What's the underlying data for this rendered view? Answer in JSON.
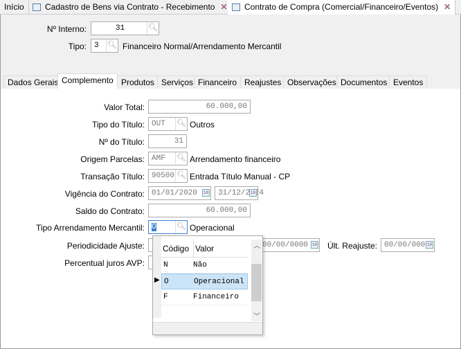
{
  "top_tabs": [
    {
      "label": "Início"
    },
    {
      "label": "Cadastro de Bens via Contrato - Recebimento"
    },
    {
      "label": "Contrato de Compra (Comercial/Financeiro/Eventos)"
    }
  ],
  "header": {
    "interno_label": "Nº Interno:",
    "interno_value": "31",
    "tipo_label": "Tipo:",
    "tipo_value": "3",
    "tipo_desc": "Financeiro Normal/Arrendamento Mercantil"
  },
  "tabs": [
    "Dados Gerais",
    "Complemento",
    "Produtos",
    "Serviços",
    "Financeiro",
    "Reajustes",
    "Observações",
    "Documentos",
    "Eventos"
  ],
  "form": {
    "valor_total_label": "Valor Total:",
    "valor_total": "60.000,00",
    "tipo_titulo_label": "Tipo do Título:",
    "tipo_titulo": "OUT",
    "tipo_titulo_desc": "Outros",
    "num_titulo_label": "Nº do Título:",
    "num_titulo": "31",
    "origem_label": "Origem Parcelas:",
    "origem": "AMF",
    "origem_desc": "Arrendamento financeiro",
    "transacao_label": "Transação Título:",
    "transacao": "90500",
    "transacao_desc": "Entrada Título Manual - CP",
    "vigencia_label": "Vigência do Contrato:",
    "vigencia_inicio": "01/01/2020",
    "vigencia_fim": "31/12/2024",
    "saldo_label": "Saldo do Contrato:",
    "saldo": "60.000,00",
    "arrend_label": "Tipo Arrendamento Mercantil:",
    "arrend": "O",
    "arrend_desc": "Operacional",
    "periodicidade_label": "Periodicidade Ajuste:",
    "periodicidade_date": "00/00/0000",
    "ult_reajuste_label": "Últ. Reajuste:",
    "ult_reajuste": "00/00/0000",
    "percentual_label": "Percentual juros AVP:"
  },
  "popup": {
    "col_codigo": "Código",
    "col_valor": "Valor",
    "rows": [
      {
        "codigo": "N",
        "valor": "Não"
      },
      {
        "codigo": "O",
        "valor": "Operacional"
      },
      {
        "codigo": "F",
        "valor": "Financeiro"
      }
    ]
  }
}
